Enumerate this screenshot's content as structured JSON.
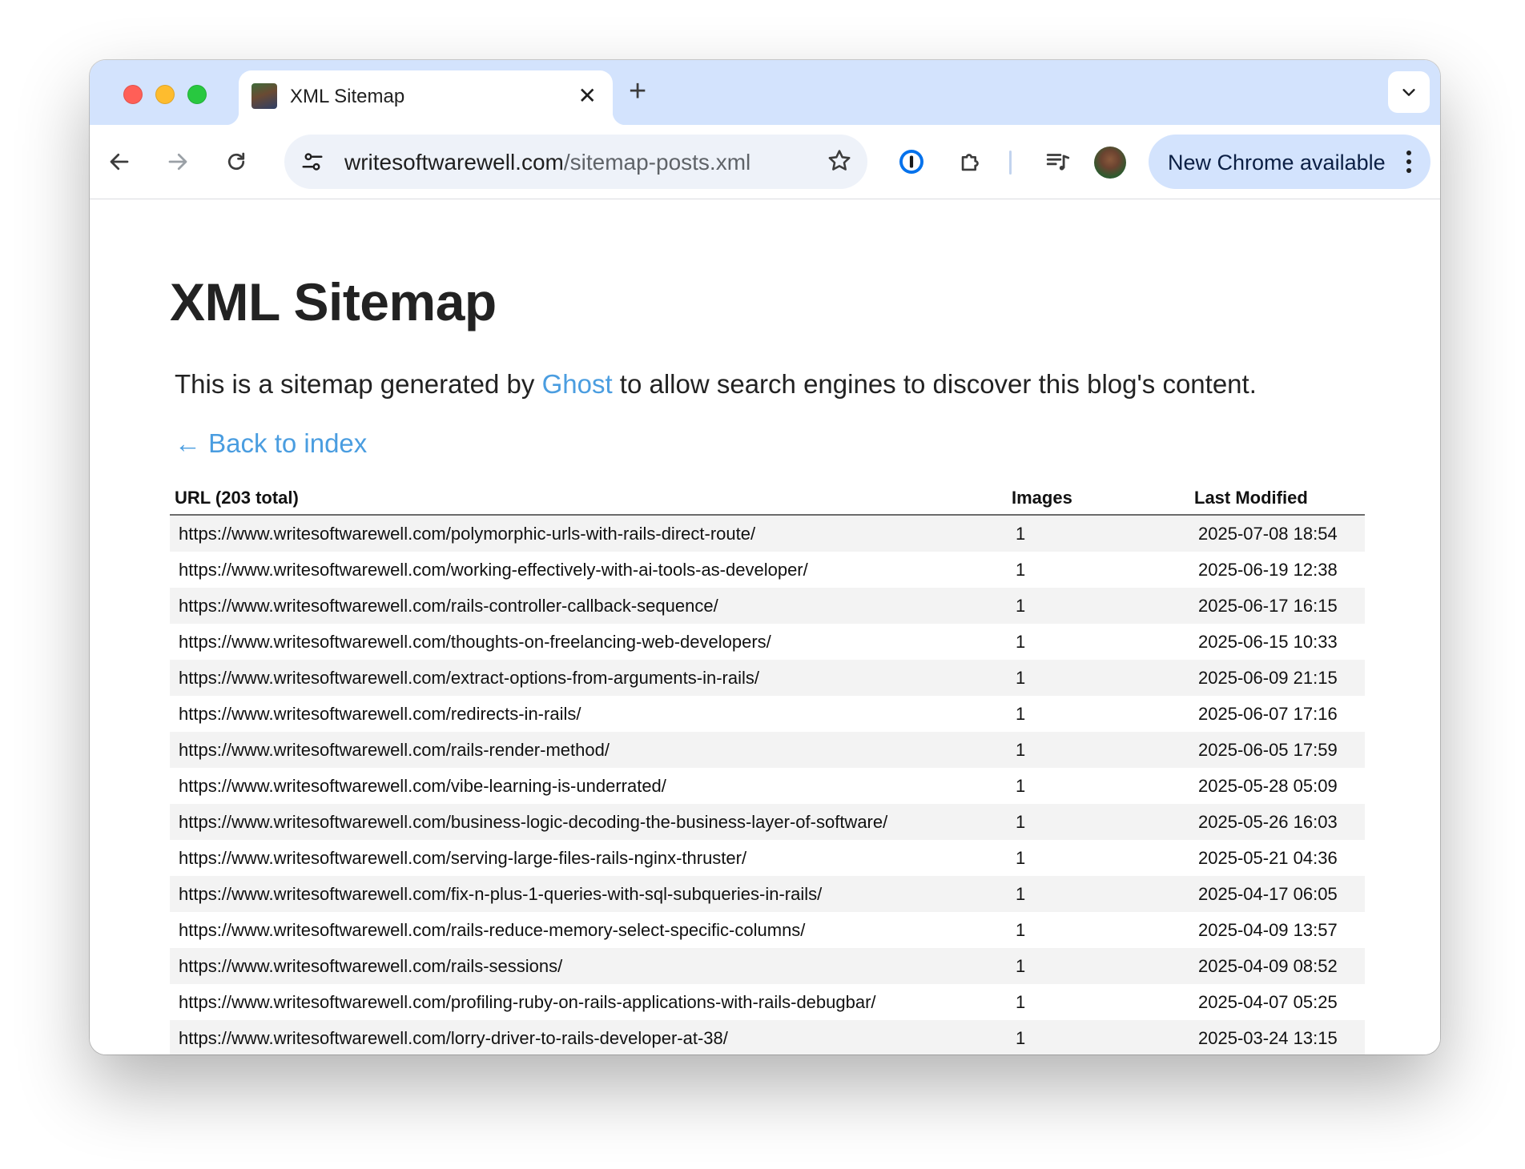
{
  "browser": {
    "tab_title": "XML Sitemap",
    "tab_close": "✕",
    "new_tab": "+",
    "url_domain": "writesoftwarewell.com",
    "url_path": "/sitemap-posts.xml",
    "update_label": "New Chrome available"
  },
  "page": {
    "title": "XML Sitemap",
    "intro_before": "This is a sitemap generated by ",
    "intro_link": "Ghost",
    "intro_after": " to allow search engines to discover this blog's content.",
    "back_link": "← Back to index"
  },
  "table": {
    "headers": {
      "url": "URL (203 total)",
      "images": "Images",
      "modified": "Last Modified"
    },
    "rows": [
      {
        "url": "https://www.writesoftwarewell.com/polymorphic-urls-with-rails-direct-route/",
        "images": "1",
        "modified": "2025-07-08 18:54"
      },
      {
        "url": "https://www.writesoftwarewell.com/working-effectively-with-ai-tools-as-developer/",
        "images": "1",
        "modified": "2025-06-19 12:38"
      },
      {
        "url": "https://www.writesoftwarewell.com/rails-controller-callback-sequence/",
        "images": "1",
        "modified": "2025-06-17 16:15"
      },
      {
        "url": "https://www.writesoftwarewell.com/thoughts-on-freelancing-web-developers/",
        "images": "1",
        "modified": "2025-06-15 10:33"
      },
      {
        "url": "https://www.writesoftwarewell.com/extract-options-from-arguments-in-rails/",
        "images": "1",
        "modified": "2025-06-09 21:15"
      },
      {
        "url": "https://www.writesoftwarewell.com/redirects-in-rails/",
        "images": "1",
        "modified": "2025-06-07 17:16"
      },
      {
        "url": "https://www.writesoftwarewell.com/rails-render-method/",
        "images": "1",
        "modified": "2025-06-05 17:59"
      },
      {
        "url": "https://www.writesoftwarewell.com/vibe-learning-is-underrated/",
        "images": "1",
        "modified": "2025-05-28 05:09"
      },
      {
        "url": "https://www.writesoftwarewell.com/business-logic-decoding-the-business-layer-of-software/",
        "images": "1",
        "modified": "2025-05-26 16:03"
      },
      {
        "url": "https://www.writesoftwarewell.com/serving-large-files-rails-nginx-thruster/",
        "images": "1",
        "modified": "2025-05-21 04:36"
      },
      {
        "url": "https://www.writesoftwarewell.com/fix-n-plus-1-queries-with-sql-subqueries-in-rails/",
        "images": "1",
        "modified": "2025-04-17 06:05"
      },
      {
        "url": "https://www.writesoftwarewell.com/rails-reduce-memory-select-specific-columns/",
        "images": "1",
        "modified": "2025-04-09 13:57"
      },
      {
        "url": "https://www.writesoftwarewell.com/rails-sessions/",
        "images": "1",
        "modified": "2025-04-09 08:52"
      },
      {
        "url": "https://www.writesoftwarewell.com/profiling-ruby-on-rails-applications-with-rails-debugbar/",
        "images": "1",
        "modified": "2025-04-07 05:25"
      },
      {
        "url": "https://www.writesoftwarewell.com/lorry-driver-to-rails-developer-at-38/",
        "images": "1",
        "modified": "2025-03-24 13:15"
      }
    ]
  }
}
